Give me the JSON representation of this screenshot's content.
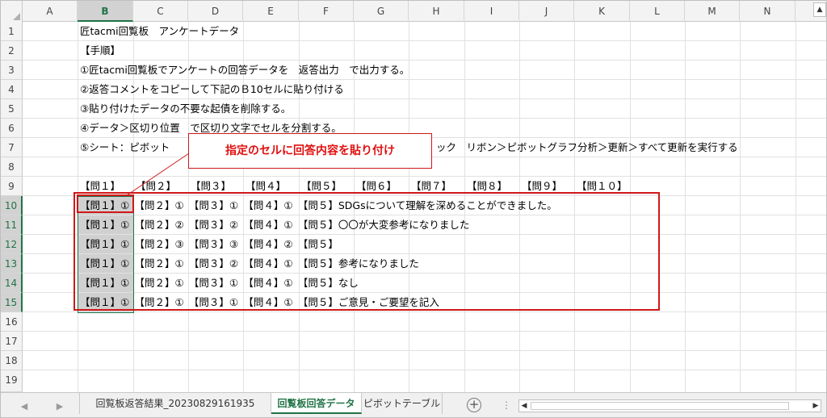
{
  "columns": [
    "A",
    "B",
    "C",
    "D",
    "E",
    "F",
    "G",
    "H",
    "I",
    "J",
    "K",
    "L",
    "M",
    "N"
  ],
  "rows": [
    "1",
    "2",
    "3",
    "4",
    "5",
    "6",
    "7",
    "8",
    "9",
    "10",
    "11",
    "12",
    "13",
    "14",
    "15",
    "16",
    "17",
    "18",
    "19"
  ],
  "active_column": "B",
  "cells": {
    "r1": "匠tacmi回覧板　アンケートデータ",
    "r2": "【手順】",
    "r3": "①匠tacmi回覧板でアンケートの回答データを　返答出力　で出力する。",
    "r4": "②返答コメントをコピーして下記のＢ10セルに貼り付ける",
    "r5": "③貼り付けたデータの不要な起債を削除する。",
    "r6": "④データ＞区切り位置　で区切り文字でセルを分割する。",
    "r7a": "⑤シート：ピボット",
    "r7b": "ック　リボン＞ピボットグラフ分析＞更新＞すべて更新を実行する"
  },
  "headers_r9": [
    "【問１】",
    "【問２】",
    "【問３】",
    "【問４】",
    "【問５】",
    "【問６】",
    "【問７】",
    "【問８】",
    "【問９】",
    "【問１０】"
  ],
  "data_rows": [
    "【問１】①　【問２】①　【問３】①　【問４】①　【問５】SDGsについて理解を深めることができました。",
    "【問１】①　【問２】②　【問３】②　【問４】①　【問５】〇〇が大変参考になりました",
    "【問１】①　【問２】③　【問３】③　【問４】②　【問５】",
    "【問１】①　【問２】①　【問３】②　【問４】①　【問５】参考になりました",
    "【問１】①　【問２】①　【問３】①　【問４】①　【問５】なし",
    "【問１】①　【問２】①　【問３】①　【問４】①　【問５】ご意見・ご要望を記入"
  ],
  "callout": "指定のセルに回答内容を貼り付け",
  "sheet_tabs": [
    "回覧板返答結果_20230829161935",
    "回覧板回答データ",
    "ピボットテーブル"
  ],
  "active_tab": "回覧板回答データ",
  "add_sheet_label": "+",
  "tabs_overflow": "⋮",
  "colors": {
    "accent": "#217346",
    "callout_red": "#d01818"
  }
}
